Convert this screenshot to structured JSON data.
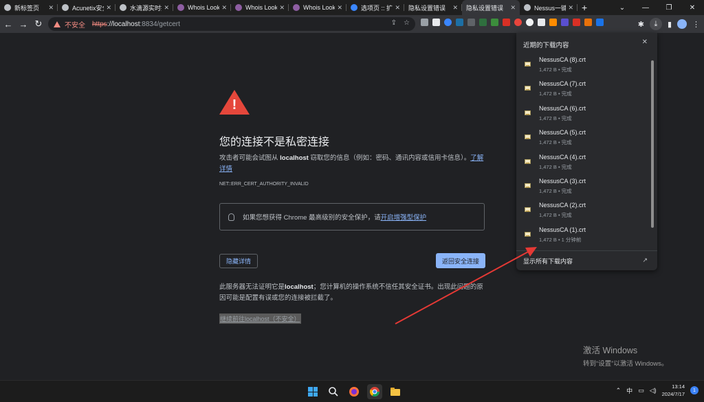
{
  "tabs": [
    {
      "label": "新标签页",
      "color": "#bdc1c6",
      "active": false
    },
    {
      "label": "Acunetix安全",
      "color": "#bdc1c6",
      "active": false
    },
    {
      "label": "水滴源实时提",
      "color": "#bdc1c6",
      "active": false
    },
    {
      "label": "Whois Lookup",
      "color": "#8e5ea2",
      "active": false
    },
    {
      "label": "Whois Lookup",
      "color": "#8e5ea2",
      "active": false
    },
    {
      "label": "Whois Lookup",
      "color": "#8e5ea2",
      "active": false
    },
    {
      "label": "选项页 :: 扩展",
      "color": "#3a86ff",
      "active": false
    },
    {
      "label": "隐私设置错误",
      "color": "",
      "active": false
    },
    {
      "label": "隐私设置错误",
      "color": "",
      "active": true
    },
    {
      "label": "Nessus一键",
      "color": "#bdc1c6",
      "active": false
    }
  ],
  "window_controls": {
    "minimize": "—",
    "maximize": "❐",
    "close": "✕",
    "dropdown": "⌄"
  },
  "toolbar": {
    "back": "←",
    "forward": "→",
    "reload": "↻",
    "insecure_label": "不安全",
    "url_scheme": "https",
    "url_host": "://localhost",
    "url_rest": ":8834/getcert"
  },
  "page": {
    "title": "您的连接不是私密连接",
    "desc_pre": "攻击者可能会试图从 ",
    "desc_host": "localhost",
    "desc_post": " 窃取您的信息（例如：密码、通讯内容或信用卡信息）。",
    "desc_link": "了解详情",
    "error_code": "NET::ERR_CERT_AUTHORITY_INVALID",
    "tip_pre": "如果您想获得 Chrome 最高级别的安全保护，请",
    "tip_link": "开启增强型保护",
    "hide_details": "隐藏详情",
    "back_to_safety": "返回安全连接",
    "detail_pre": "此服务器无法证明它是",
    "detail_host": "localhost",
    "detail_post": "；您计算机的操作系统不信任其安全证书。出现此问题的原因可能是配置有误或您的连接被拦截了。",
    "proceed": "继续前往localhost（不安全）"
  },
  "downloads": {
    "header": "近期的下载内容",
    "close": "✕",
    "items": [
      {
        "name": "NessusCA (8).crt",
        "meta": "1,472 B • 完成"
      },
      {
        "name": "NessusCA (7).crt",
        "meta": "1,472 B • 完成"
      },
      {
        "name": "NessusCA (6).crt",
        "meta": "1,472 B • 完成"
      },
      {
        "name": "NessusCA (5).crt",
        "meta": "1,472 B • 完成"
      },
      {
        "name": "NessusCA (4).crt",
        "meta": "1,472 B • 完成"
      },
      {
        "name": "NessusCA (3).crt",
        "meta": "1,472 B • 完成"
      },
      {
        "name": "NessusCA (2).crt",
        "meta": "1,472 B • 完成"
      },
      {
        "name": "NessusCA (1).crt",
        "meta": "1,472 B • 1 分钟前"
      }
    ],
    "show_all": "显示所有下载内容"
  },
  "activation": {
    "title": "激活 Windows",
    "subtitle": "转到“设置”以激活 Windows。"
  },
  "taskbar": {
    "tray_ime": "中",
    "clock_time": "13:14",
    "clock_date": "2024/7/17",
    "notifications": "1"
  }
}
